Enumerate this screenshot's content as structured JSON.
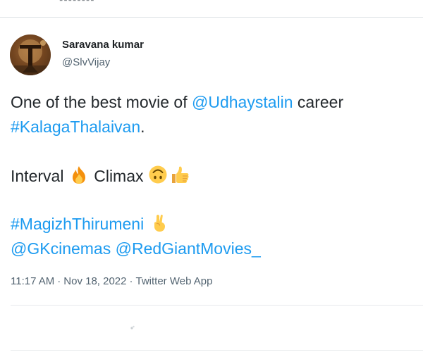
{
  "tweet": {
    "author": {
      "display_name": "Saravana kumar",
      "handle": "@SlvVijay"
    },
    "body": {
      "line1_text": "One of the best movie of ",
      "line1_mention": "@Udhaystalin",
      "line1_trailing": " career",
      "line2_hashtag": "#KalagaThalaivan",
      "line2_trailing": ".",
      "line3_word1": "Interval",
      "line3_word2": "Climax",
      "line4_hashtag": "#MagizhThirumeni",
      "line5_mention1": "@GKcinemas",
      "line5_mention2": "@RedGiantMovies_"
    },
    "emoji": {
      "after_interval": "fire",
      "after_climax_1": "upside-down-face",
      "after_climax_2": "thumbs-up",
      "after_hashtag": "crossed-fingers"
    },
    "meta": {
      "time": "11:17 AM",
      "separator": "·",
      "date": "Nov 18, 2022",
      "source": "Twitter Web App"
    }
  },
  "colors": {
    "link": "#1d9bf0",
    "text": "#23282c",
    "muted": "#536471",
    "divider": "#e7eaec"
  }
}
